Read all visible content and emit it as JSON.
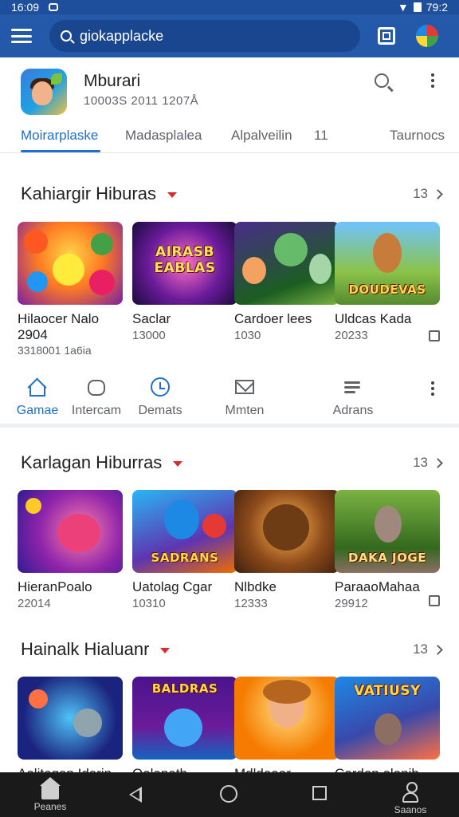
{
  "status_bar": {
    "time": "16:09",
    "battery": "79:2"
  },
  "search": {
    "value": "giokapplacke"
  },
  "app": {
    "title": "Mburari",
    "subtitle": "10003S 2011 1207Å"
  },
  "tabs": [
    {
      "label": "Moirarplaske",
      "active": true
    },
    {
      "label": "Madasplalea"
    },
    {
      "label": "Alpalveilin"
    },
    {
      "label": "11"
    },
    {
      "label": "Taurnocs"
    }
  ],
  "sections": [
    {
      "title": "Kahiargir Hiburas",
      "count": "13",
      "cards": [
        {
          "name": "Hilaocer Nalo 2904",
          "num": "3318001 1a6ia",
          "thumb_label": ""
        },
        {
          "name": "Saclar",
          "num": "13000",
          "thumb_label": "AIRASB EABLAS"
        },
        {
          "name": "Cardoer lees",
          "num": "1030",
          "thumb_label": ""
        },
        {
          "name": "Uldcas Kada",
          "num": "20233",
          "thumb_label": "DOUDEVAS"
        }
      ]
    },
    {
      "title": "Karlagan Hiburras",
      "count": "13",
      "cards": [
        {
          "name": "HieranPoalo",
          "num": "22014",
          "thumb_label": ""
        },
        {
          "name": "Uatolag Cgar",
          "num": "10310",
          "thumb_label": "SADRANS"
        },
        {
          "name": "Nlbdke",
          "num": "12333",
          "thumb_label": ""
        },
        {
          "name": "ParaaoMahaa",
          "num": "29912",
          "thumb_label": "DAKA JOGE"
        }
      ]
    },
    {
      "title": "Hainalk Hialuanr",
      "count": "13",
      "cards": [
        {
          "name": "Aolitegan Idarin",
          "num": "",
          "thumb_label": ""
        },
        {
          "name": "Oolanath",
          "num": "",
          "thumb_label": "BALDRAS"
        },
        {
          "name": "Mdldeaar",
          "num": "",
          "thumb_label": ""
        },
        {
          "name": "Cordon olanib",
          "num": "",
          "thumb_label": "VATIUSY"
        }
      ]
    }
  ],
  "mid_nav": [
    {
      "label": "Gamae",
      "icon": "home-icon",
      "active": true
    },
    {
      "label": "Intercam",
      "icon": "gift-icon"
    },
    {
      "label": "Demats",
      "icon": "clock-icon"
    },
    {
      "label": "Mmten",
      "icon": "mail-icon"
    },
    {
      "label": "Adrans",
      "icon": "lines-icon"
    }
  ],
  "bottom_nav": {
    "home_label": "Peanes",
    "profile_label": "Saanos"
  },
  "colors": {
    "primary": "#2458a8",
    "accent": "#1e6fd0",
    "caret": "#d32f2f"
  }
}
